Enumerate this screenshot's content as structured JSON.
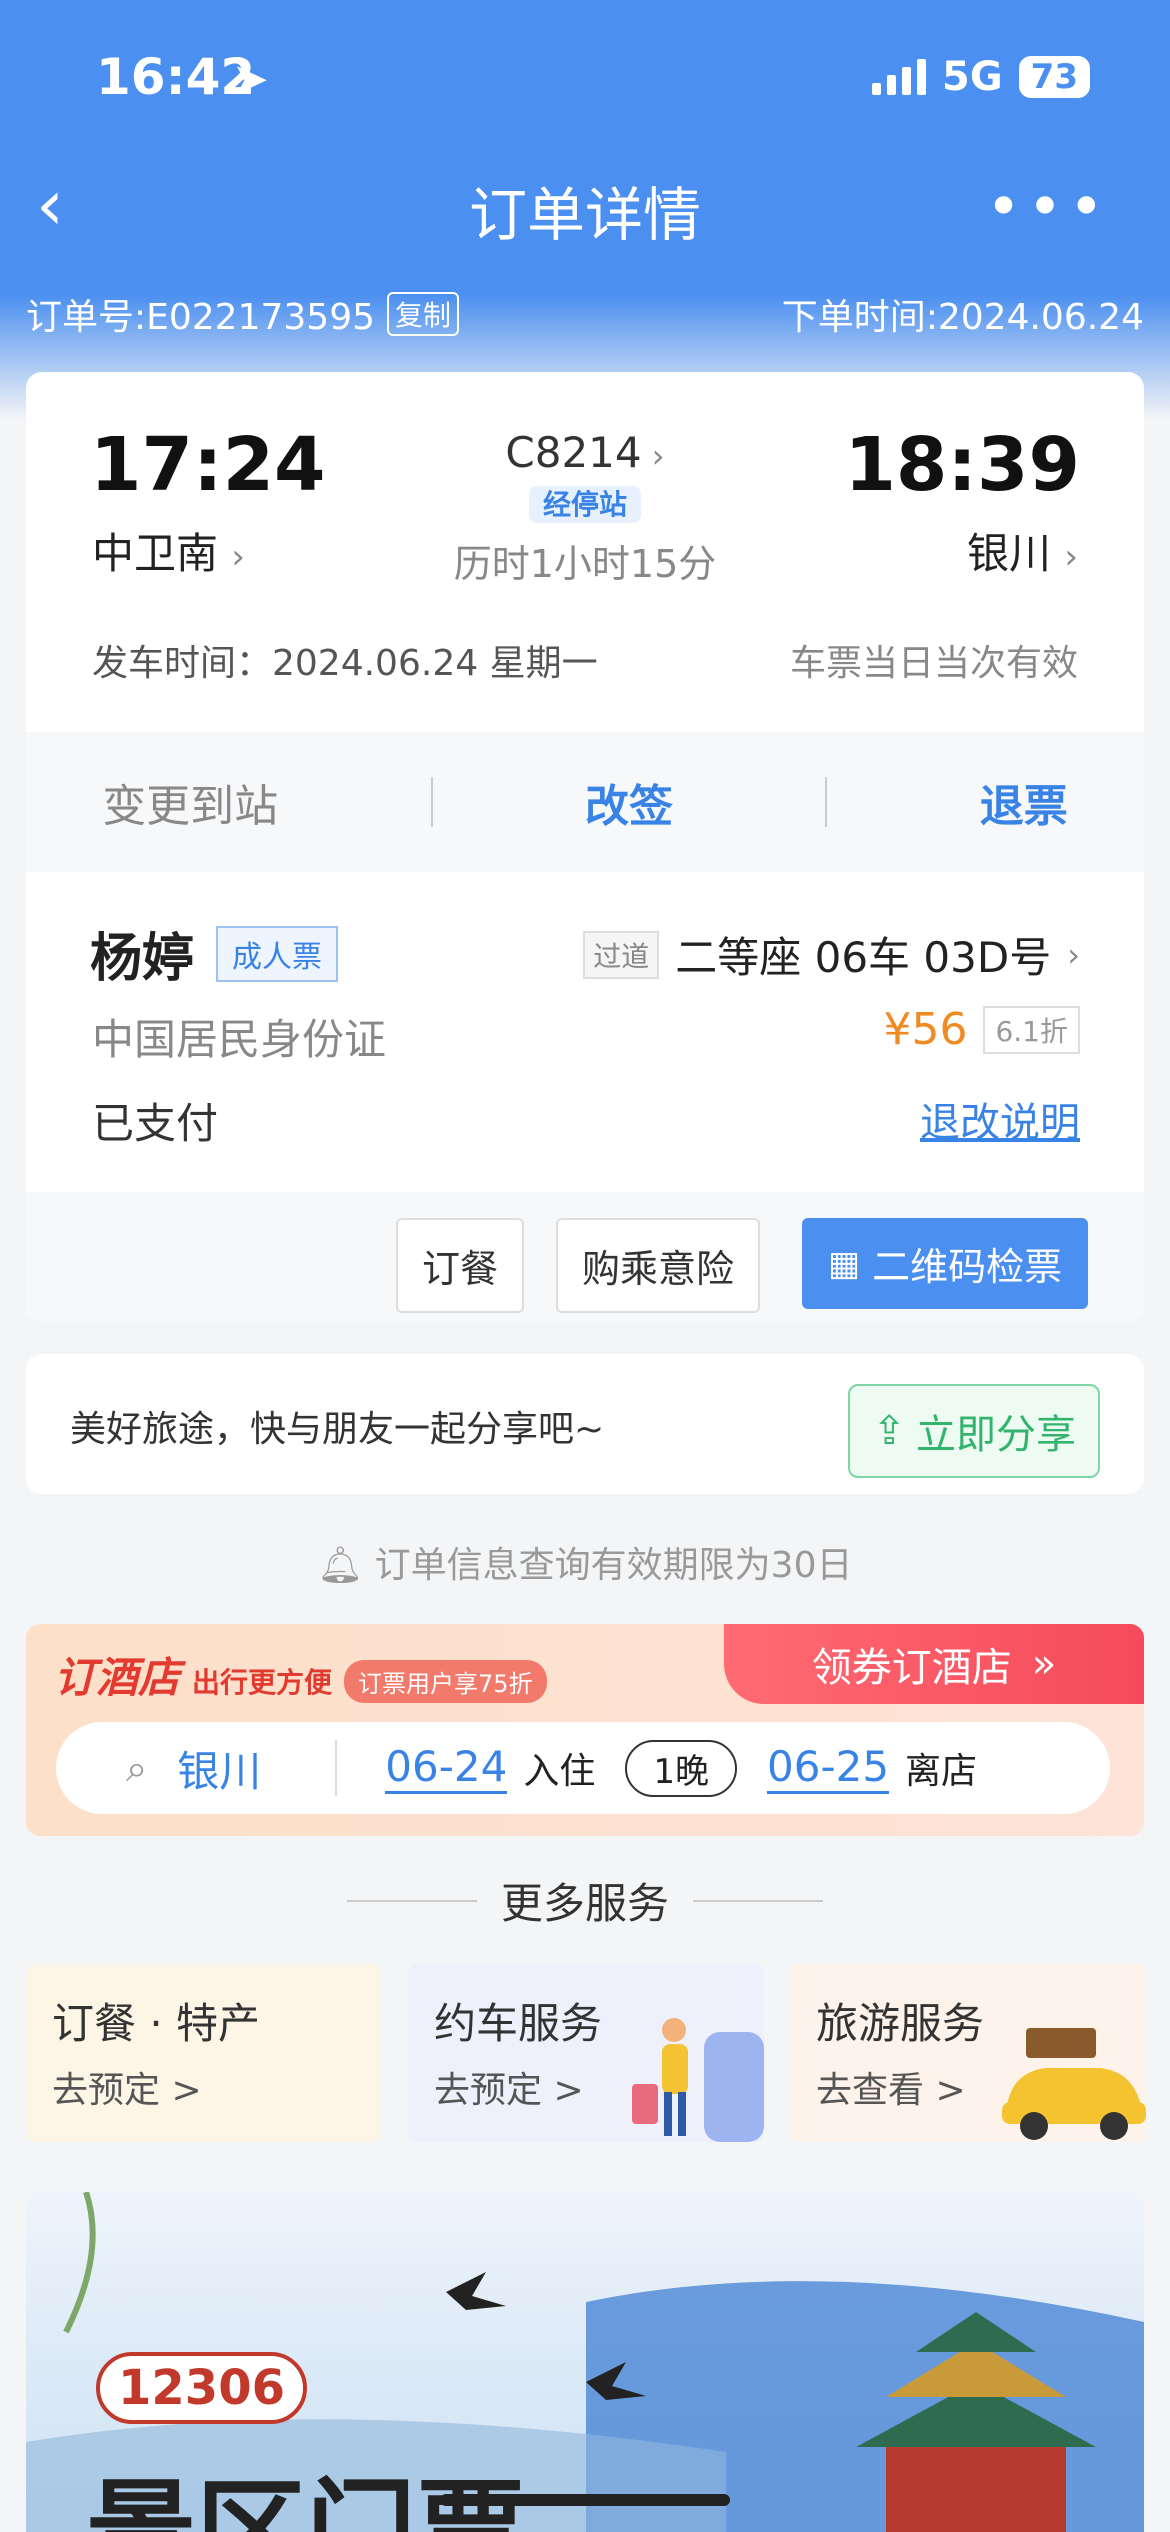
{
  "status_bar": {
    "time": "16:42",
    "network": "5G",
    "battery": "73"
  },
  "nav": {
    "title": "订单详情"
  },
  "order": {
    "number": "订单号:E022173595",
    "copy_label": "复制",
    "placed_time": "下单时间:2024.06.24"
  },
  "trip": {
    "depart_time": "17:24",
    "depart_station": "中卫南",
    "train_no": "C8214",
    "stops_label": "经停站",
    "duration": "历时1小时15分",
    "arrive_time": "18:39",
    "arrive_station": "银川",
    "date_line": "发车时间：2024.06.24 星期一",
    "validity": "车票当日当次有效"
  },
  "actions": {
    "change_station": "变更到站",
    "reschedule": "改签",
    "refund": "退票"
  },
  "passenger": {
    "name": "杨婷",
    "ticket_type": "成人票",
    "seat_tag": "过道",
    "seat": "二等座 06车 03D号",
    "id_type": "中国居民身份证",
    "price": "¥56",
    "discount": "6.1折",
    "status": "已支付",
    "rules_link": "退改说明",
    "btn_meal": "订餐",
    "btn_insurance": "购乘意险",
    "btn_qr": "二维码检票"
  },
  "share": {
    "text": "美好旅途，快与朋友一起分享吧~",
    "button": "立即分享"
  },
  "notice": "订单信息查询有效期限为30日",
  "hotel": {
    "title": "订酒店",
    "slogan": "出行更方便",
    "promo": "订票用户享75折",
    "cta": "领券订酒店",
    "city": "银川",
    "checkin_date": "06-24",
    "checkin_label": "入住",
    "nights": "1晚",
    "checkout_date": "06-25",
    "checkout_label": "离店"
  },
  "more_services": {
    "title": "更多服务",
    "items": [
      {
        "title": "订餐 · 特产",
        "sub": "去预定 >"
      },
      {
        "title": "约车服务",
        "sub": "去预定 >"
      },
      {
        "title": "旅游服务",
        "sub": "去查看 >"
      }
    ]
  },
  "banner": {
    "logo": "12306",
    "headline": "景区门票"
  },
  "colors": {
    "primary": "#4b8ff0",
    "accent_blue": "#3a83e6",
    "price_orange": "#f08a24",
    "hotel_red": "#f54a5b",
    "share_green": "#32b36e"
  }
}
